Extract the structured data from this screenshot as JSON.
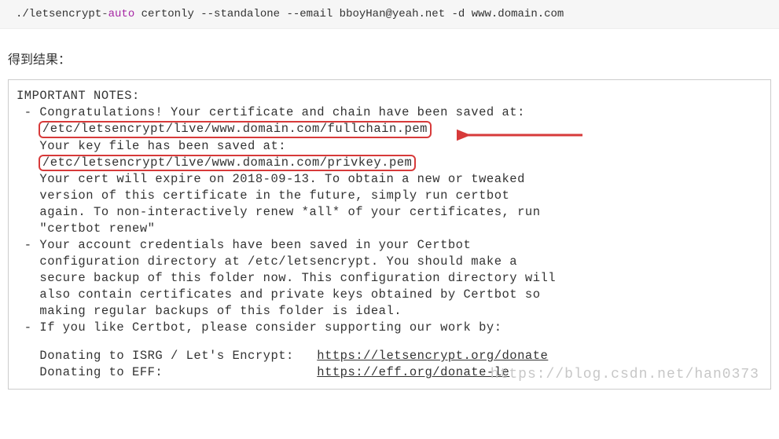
{
  "command": {
    "prefix": "./letsencrypt",
    "dash": "-",
    "auto": "auto",
    "rest": " certonly --standalone --email bboyHan@yeah.net -d www.domain.com"
  },
  "result_label": "得到结果：",
  "notes": {
    "header": "IMPORTANT NOTES:",
    "congrats": " - Congratulations! Your certificate and chain have been saved at:",
    "cert_path": "/etc/letsencrypt/live/www.domain.com/fullchain.pem",
    "key_saved": "   Your key file has been saved at:",
    "key_path": "/etc/letsencrypt/live/www.domain.com/privkey.pem",
    "expire1": "   Your cert will expire on 2018-09-13. To obtain a new or tweaked",
    "expire2": "   version of this certificate in the future, simply run certbot",
    "expire3": "   again. To non-interactively renew *all* of your certificates, run",
    "expire4": "   \"certbot renew\"",
    "acct1": " - Your account credentials have been saved in your Certbot",
    "acct2": "   configuration directory at /etc/letsencrypt. You should make a",
    "acct3": "   secure backup of this folder now. This configuration directory will",
    "acct4": "   also contain certificates and private keys obtained by Certbot so",
    "acct5": "   making regular backups of this folder is ideal.",
    "support": " - If you like Certbot, please consider supporting our work by:",
    "donate_isrg_label": "   Donating to ISRG / Let's Encrypt:   ",
    "donate_isrg_url": "https://letsencrypt.org/donate",
    "donate_eff_label": "   Donating to EFF:                    ",
    "donate_eff_url": "https://eff.org/donate-le"
  },
  "watermark": "https://blog.csdn.net/han0373"
}
